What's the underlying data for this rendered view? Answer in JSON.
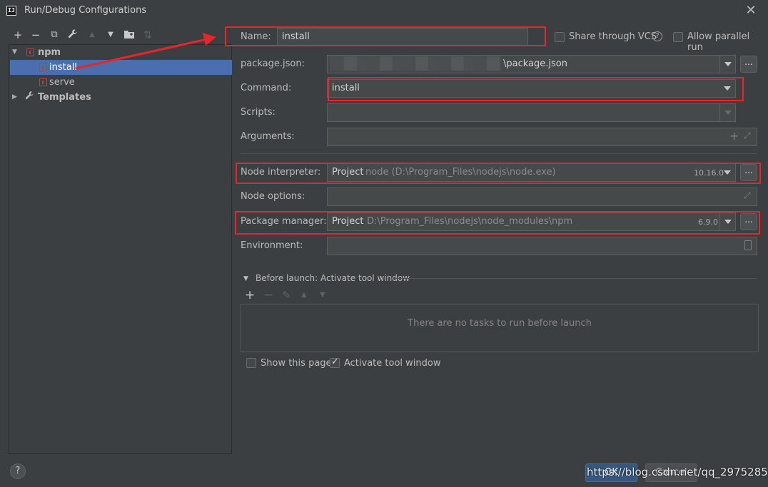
{
  "window": {
    "title": "Run/Debug Configurations",
    "app_icon_label": "IJ"
  },
  "toolbar": {
    "add": "+",
    "remove": "−",
    "copy": "⧉",
    "edit": "🔧",
    "move_up": "▲",
    "move_down": "▼",
    "folder": "▣",
    "sort": "⇅"
  },
  "tree": {
    "npm_label": "npm",
    "install_label": "install",
    "serve_label": "serve",
    "templates_label": "Templates"
  },
  "form": {
    "name_label": "Name:",
    "name_value": "install",
    "share_vcs_label": "Share through VCS",
    "share_vcs_help": "?",
    "parallel_label": "Allow parallel run",
    "package_json_label": "package.json:",
    "package_json_value": "\\package.json",
    "command_label": "Command:",
    "command_value": "install",
    "scripts_label": "Scripts:",
    "arguments_label": "Arguments:",
    "node_interp_label": "Node interpreter:",
    "node_interp_project": "Project",
    "node_interp_path": "node (D:\\Program_Files\\nodejs\\node.exe)",
    "node_version": "10.16.0",
    "node_options_label": "Node options:",
    "pkg_mgr_label": "Package manager:",
    "pkg_mgr_project": "Project",
    "pkg_mgr_path": "D:\\Program_Files\\nodejs\\node_modules\\npm",
    "pkg_mgr_version": "6.9.0",
    "environment_label": "Environment:",
    "browse_label": "..."
  },
  "before_launch": {
    "header": "Before launch: Activate tool window",
    "empty_text": "There are no tasks to run before launch",
    "add": "+",
    "remove": "−",
    "edit": "✎",
    "up": "▲",
    "down": "▼"
  },
  "options": {
    "show_page_label": "Show this page",
    "activate_window_label": "Activate tool window"
  },
  "footer": {
    "help": "?",
    "ok_label": "OK",
    "cancel_label": "Cancel",
    "watermark": "https://blog.csdn.net/qq_29752857"
  },
  "colors": {
    "accent": "#4b6eaf",
    "annotation_red": "#e8262a",
    "background": "#3c3f41"
  }
}
